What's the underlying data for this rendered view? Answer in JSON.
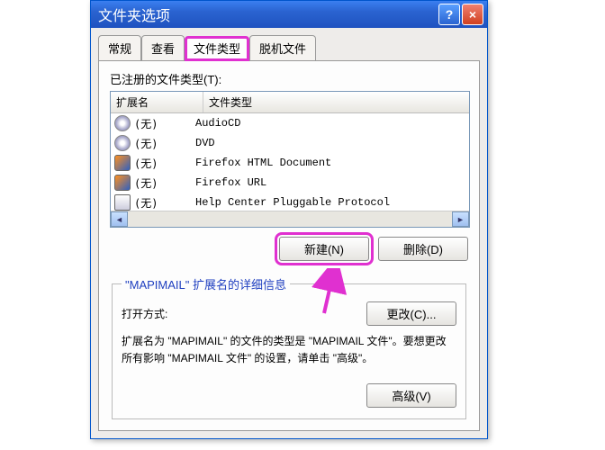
{
  "titlebar": {
    "title": "文件夹选项",
    "help_symbol": "?",
    "close_symbol": "×"
  },
  "tabs": {
    "general": "常规",
    "view": "查看",
    "filetypes": "文件类型",
    "offline": "脱机文件"
  },
  "registered_label": "已注册的文件类型(T):",
  "columns": {
    "ext": "扩展名",
    "type": "文件类型"
  },
  "rows": [
    {
      "icon": "cd",
      "ext": "(无)",
      "type": "AudioCD"
    },
    {
      "icon": "cd",
      "ext": "(无)",
      "type": "DVD"
    },
    {
      "icon": "ff",
      "ext": "(无)",
      "type": "Firefox HTML Document"
    },
    {
      "icon": "ff",
      "ext": "(无)",
      "type": "Firefox URL"
    },
    {
      "icon": "hp",
      "ext": "(无)",
      "type": "Help Center Pluggable Protocol"
    }
  ],
  "buttons": {
    "new": "新建(N)",
    "delete": "删除(D)",
    "change": "更改(C)...",
    "advanced": "高级(V)"
  },
  "details": {
    "legend": "\"MAPIMAIL\" 扩展名的详细信息",
    "open_label": "打开方式:",
    "description": "扩展名为 \"MAPIMAIL\" 的文件的类型是 \"MAPIMAIL 文件\"。要想更改所有影响 \"MAPIMAIL 文件\" 的设置，请单击 \"高级\"。"
  },
  "annotation_color": "#e030d0"
}
